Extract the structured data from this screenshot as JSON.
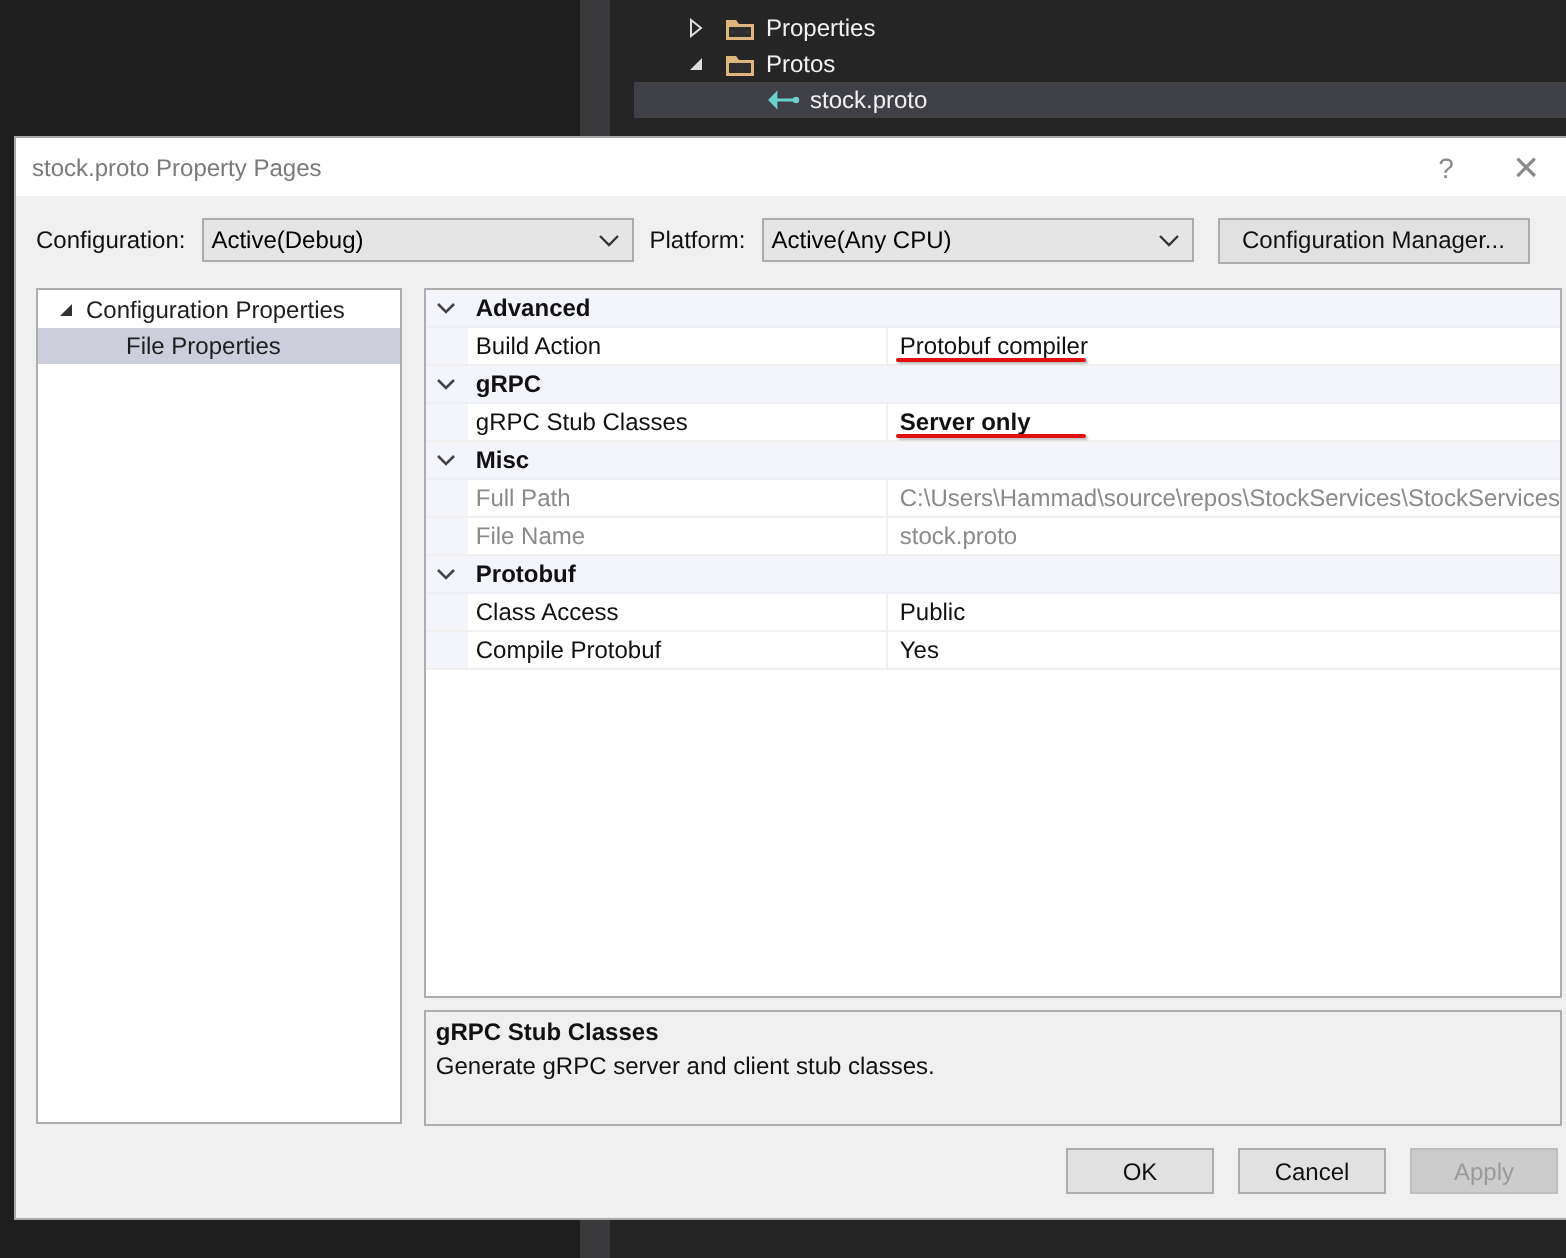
{
  "solution_explorer": {
    "items": [
      {
        "label": "Properties",
        "expanded": false,
        "selected": false,
        "kind": "folder"
      },
      {
        "label": "Protos",
        "expanded": true,
        "selected": false,
        "kind": "folder"
      },
      {
        "label": "stock.proto",
        "selected": true,
        "kind": "file"
      }
    ]
  },
  "dialog": {
    "title": "stock.proto Property Pages",
    "help": "?",
    "close": "×",
    "configuration": {
      "label": "Configuration:",
      "value": "Active(Debug)"
    },
    "platform": {
      "label": "Platform:",
      "value": "Active(Any CPU)"
    },
    "config_manager_button": "Configuration Manager...",
    "tree": [
      {
        "label": "Configuration Properties",
        "expanded": true,
        "selected": false,
        "children": [
          {
            "label": "File Properties",
            "selected": true
          }
        ]
      }
    ],
    "categories": [
      {
        "name": "Advanced",
        "expanded": true,
        "properties": [
          {
            "name": "Build Action",
            "value": "Protobuf compiler",
            "bold": false,
            "disabled": false,
            "underlined": true
          }
        ]
      },
      {
        "name": "gRPC",
        "expanded": true,
        "properties": [
          {
            "name": "gRPC Stub Classes",
            "value": "Server only",
            "bold": true,
            "disabled": false,
            "underlined": true
          }
        ]
      },
      {
        "name": "Misc",
        "expanded": true,
        "properties": [
          {
            "name": "Full Path",
            "value": "C:\\Users\\Hammad\\source\\repos\\StockServices\\StockServices",
            "bold": false,
            "disabled": true,
            "underlined": false
          },
          {
            "name": "File Name",
            "value": "stock.proto",
            "bold": false,
            "disabled": true,
            "underlined": false
          }
        ]
      },
      {
        "name": "Protobuf",
        "expanded": true,
        "properties": [
          {
            "name": "Class Access",
            "value": "Public",
            "bold": false,
            "disabled": false,
            "underlined": false
          },
          {
            "name": "Compile Protobuf",
            "value": "Yes",
            "bold": false,
            "disabled": false,
            "underlined": false
          }
        ]
      }
    ],
    "description": {
      "title": "gRPC Stub Classes",
      "text": "Generate gRPC server and client stub classes."
    },
    "buttons": [
      {
        "label": "OK",
        "disabled": false
      },
      {
        "label": "Cancel",
        "disabled": false
      },
      {
        "label": "Apply",
        "disabled": true
      }
    ]
  }
}
